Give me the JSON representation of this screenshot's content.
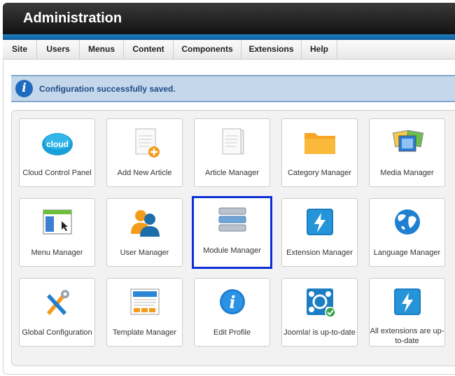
{
  "header": {
    "title": "Administration"
  },
  "menu": [
    "Site",
    "Users",
    "Menus",
    "Content",
    "Components",
    "Extensions",
    "Help"
  ],
  "alert": {
    "message": "Configuration successfully saved."
  },
  "tiles": [
    {
      "label": "Cloud Control Panel",
      "icon": "cloud-icon"
    },
    {
      "label": "Add New Article",
      "icon": "add-article-icon"
    },
    {
      "label": "Article Manager",
      "icon": "article-icon"
    },
    {
      "label": "Category Manager",
      "icon": "folder-icon"
    },
    {
      "label": "Media Manager",
      "icon": "media-icon"
    },
    {
      "label": "Menu Manager",
      "icon": "menu-window-icon"
    },
    {
      "label": "User Manager",
      "icon": "users-icon"
    },
    {
      "label": "Module Manager",
      "icon": "module-stack-icon",
      "selected": true
    },
    {
      "label": "Extension Manager",
      "icon": "lightning-icon"
    },
    {
      "label": "Language Manager",
      "icon": "globe-icon"
    },
    {
      "label": "Global Configuration",
      "icon": "tools-icon"
    },
    {
      "label": "Template Manager",
      "icon": "template-icon"
    },
    {
      "label": "Edit Profile",
      "icon": "info-icon"
    },
    {
      "label": "Joomla! is up-to-date",
      "icon": "joomla-check-icon"
    },
    {
      "label": "All extensions are up-to-date",
      "icon": "lightning-icon"
    }
  ],
  "colors": {
    "header": "#1a1a1a",
    "accent": "#1a76bb",
    "alert_bg": "#c5d7ea",
    "selection": "#0d2fd6"
  }
}
